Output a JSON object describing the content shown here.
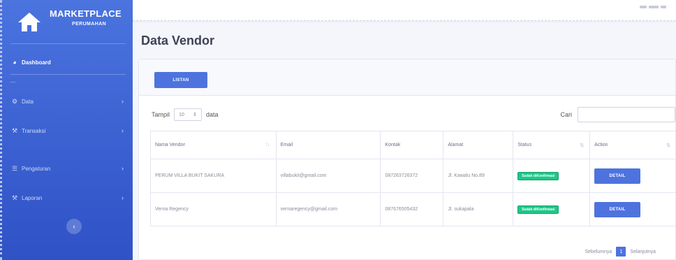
{
  "brand": {
    "title": "MARKETPLACE",
    "subtitle": "PERUMAHAN"
  },
  "sidebar": {
    "dashboard_label": "Dashboard",
    "heading": "—",
    "items": [
      {
        "label": "Data",
        "icon": "cog-icon"
      },
      {
        "label": "Transaksi",
        "icon": "wrench-icon"
      },
      {
        "label": "Pengaturan",
        "icon": "sliders-icon"
      },
      {
        "label": "Laporan",
        "icon": "wrench-icon"
      }
    ],
    "toggle_glyph": "‹"
  },
  "page": {
    "title": "Data Vendor"
  },
  "toolbar": {
    "add_label": "LISTAN"
  },
  "table_controls": {
    "show_label": "Tampil",
    "show_value": "10",
    "show_suffix": "data",
    "search_label": "Cari",
    "search_value": ""
  },
  "table": {
    "headers": [
      "Nama Vendor",
      "Email",
      "Kontak",
      "Alamat",
      "Status",
      "Action"
    ],
    "rows": [
      {
        "nama": "PERUM VILLA BUKIT SAKURA",
        "email": "villabukit@gmail.com",
        "kontak": "087263726372",
        "alamat": "Jl. Kawalu No.89",
        "status": "Sudah diKonfirmasi",
        "action": "DETAIL"
      },
      {
        "nama": "Verna Regency",
        "email": "vernaregency@gmail.com",
        "kontak": "087676505432",
        "alamat": "Jl. sukapala",
        "status": "Sudah diKonfirmasi",
        "action": "DETAIL"
      }
    ]
  },
  "pagination": {
    "prev": "Sebelumnya",
    "page": "1",
    "next": "Selanjutnya"
  },
  "colors": {
    "sidebar": "#4b74df",
    "primary": "#4e73df",
    "success": "#1cc88a",
    "background": "#f4f6fb"
  }
}
